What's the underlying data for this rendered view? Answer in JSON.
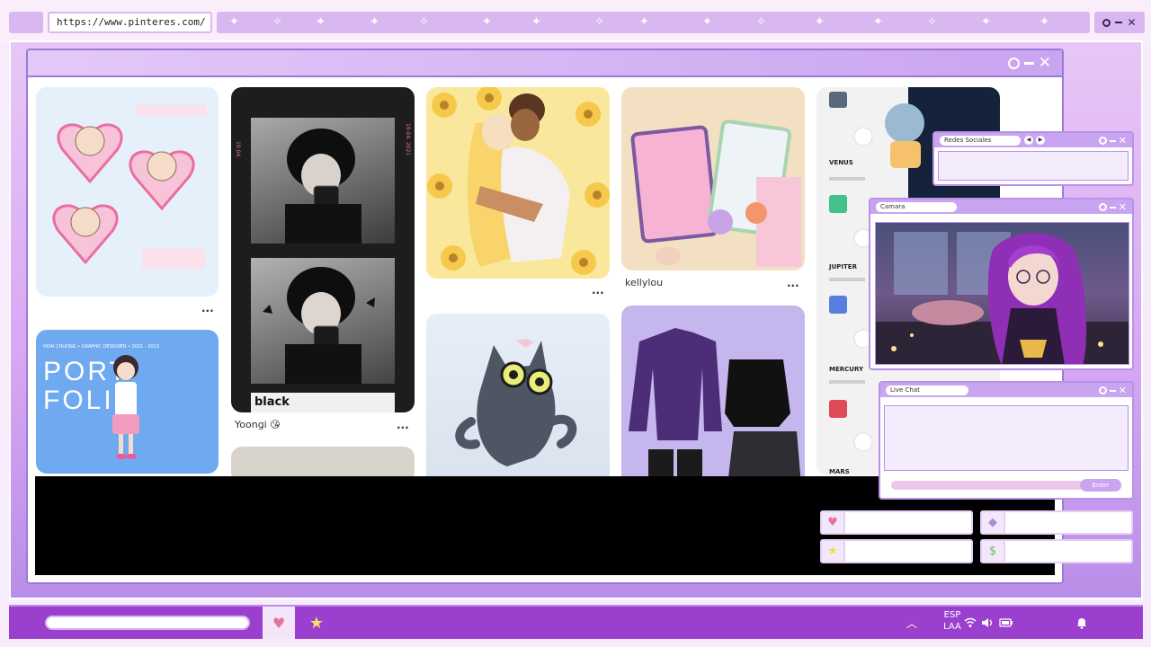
{
  "browser": {
    "url": "https://www.pinteres.com/"
  },
  "feed": {
    "pins": [
      {
        "label": "",
        "art": "chibi bases on pink hearts"
      },
      {
        "label": "Yoongi 😘"
      },
      {
        "label": ""
      },
      {
        "label": "kellylou"
      },
      {
        "label": ""
      },
      {
        "label": ""
      },
      {
        "label": ""
      },
      {
        "label": ""
      }
    ],
    "portfolio": {
      "caption": "HOAI CHUONG  •  GRAPHIC DESIGNER  •  2021 - 2023",
      "line1": "PORT",
      "line2": "FOLIO"
    },
    "poster": {
      "tag": "black",
      "date_left": "19.04.",
      "date_right": "19.04. 2021"
    },
    "planets": [
      "VENUS",
      "JUPITER",
      "MERCURY",
      "MARS"
    ],
    "more_label": "..."
  },
  "widgets": {
    "redes": {
      "title": "Redes Sociales"
    },
    "camara": {
      "title": "Camara"
    },
    "chat": {
      "title": "Live Chat",
      "enter_label": "Enter"
    }
  },
  "taskbar": {
    "lang_top": "ESP",
    "lang_bottom": "LAA"
  },
  "colors": {
    "accent": "#9b3fce",
    "lavender": "#d9b8f2",
    "border": "#9b7bd4"
  }
}
